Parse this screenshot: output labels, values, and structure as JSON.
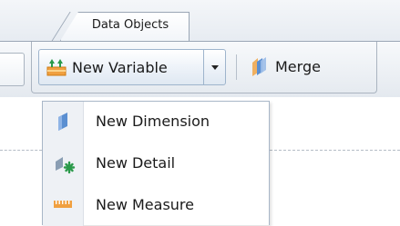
{
  "ribbon": {
    "tab": {
      "label": "Data Objects"
    },
    "new_variable_button": {
      "label": "New Variable",
      "icon": "new-variable-icon"
    },
    "merge_button": {
      "label": "Merge",
      "icon": "merge-icon"
    }
  },
  "menu": {
    "items": [
      {
        "label": "New Dimension",
        "icon": "dimension-icon"
      },
      {
        "label": "New Detail",
        "icon": "detail-icon"
      },
      {
        "label": "New Measure",
        "icon": "measure-icon"
      }
    ]
  },
  "colors": {
    "dimension_blue": "#5b8fd1",
    "detail_green": "#2a9a4a",
    "measure_orange": "#f0a040"
  }
}
